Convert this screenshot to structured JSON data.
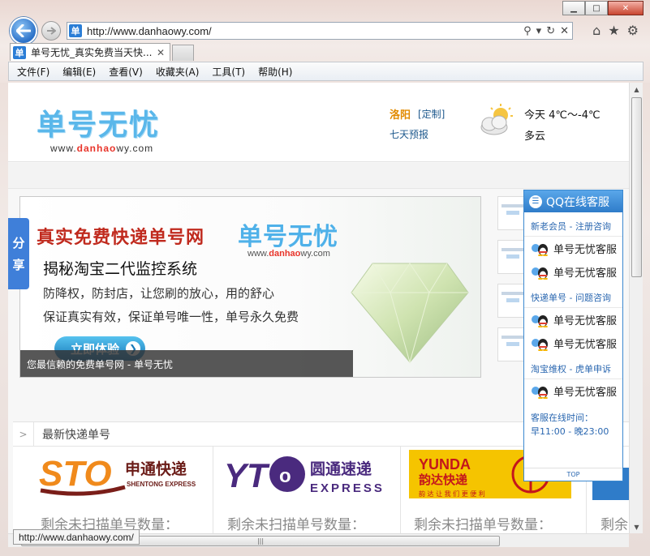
{
  "browser": {
    "url": "http://www.danhaowy.com/",
    "tab_title": "单号无忧_真实免费当天快...",
    "favicon_char": "单",
    "status_url": "http://www.danhaowy.com/",
    "menu": [
      "文件(F)",
      "编辑(E)",
      "查看(V)",
      "收藏夹(A)",
      "工具(T)",
      "帮助(H)"
    ]
  },
  "header": {
    "logo": "单号无忧",
    "logo_url_pre": "www.",
    "logo_url_mid": "danhao",
    "logo_url_post": "wy.com",
    "city": "洛阳",
    "customize": "[定制]",
    "forecast": "七天预报",
    "temp": "今天 4℃～-4℃",
    "sky": "多云"
  },
  "banner": {
    "title": "真实免费快递单号网",
    "logo": "单号无忧",
    "url_pre": "www.",
    "url_mid": "danhao",
    "url_post": "wy.com",
    "subtitle": "揭秘淘宝二代监控系统",
    "line1": "防降权，防封店，让您刷的放心，用的舒心",
    "line2": "保证真实有效，保证单号唯一性，单号永久免费",
    "button": "立即体验",
    "caption": "您最信赖的免费单号网 - 单号无忧"
  },
  "share": [
    "分",
    "享"
  ],
  "latest": {
    "title": "最新快递单号",
    "count_label": "剩余未扫描单号数量：",
    "count_label_partial": "剩余",
    "couriers": [
      {
        "name": "STO",
        "cn": "申通快递",
        "en": "SHENTONG EXPRESS"
      },
      {
        "name": "YTO",
        "cn": "圆通速递",
        "en": "EXPRESS"
      },
      {
        "name": "YUNDA",
        "cn": "韵达快递",
        "slogan": "韵 达 让 我 们 更 便 利"
      }
    ]
  },
  "qq_panel": {
    "title": "QQ在线客服",
    "sections": [
      {
        "label": "新老会员 - 注册咨询",
        "agents": [
          "单号无忧客服",
          "单号无忧客服"
        ]
      },
      {
        "label": "快递单号 - 问题咨询",
        "agents": [
          "单号无忧客服",
          "单号无忧客服"
        ]
      },
      {
        "label": "淘宝维权 - 虎单申诉",
        "agents": [
          "单号无忧客服"
        ]
      }
    ],
    "hours_label": "客服在线时间：",
    "hours": "早11:00 - 晚23:00",
    "top": "TOP"
  },
  "colors": {
    "accent": "#3c89d0",
    "logo_blue": "#5ab7ea",
    "brand_red": "#c02a1e",
    "city_orange": "#e28b00"
  }
}
